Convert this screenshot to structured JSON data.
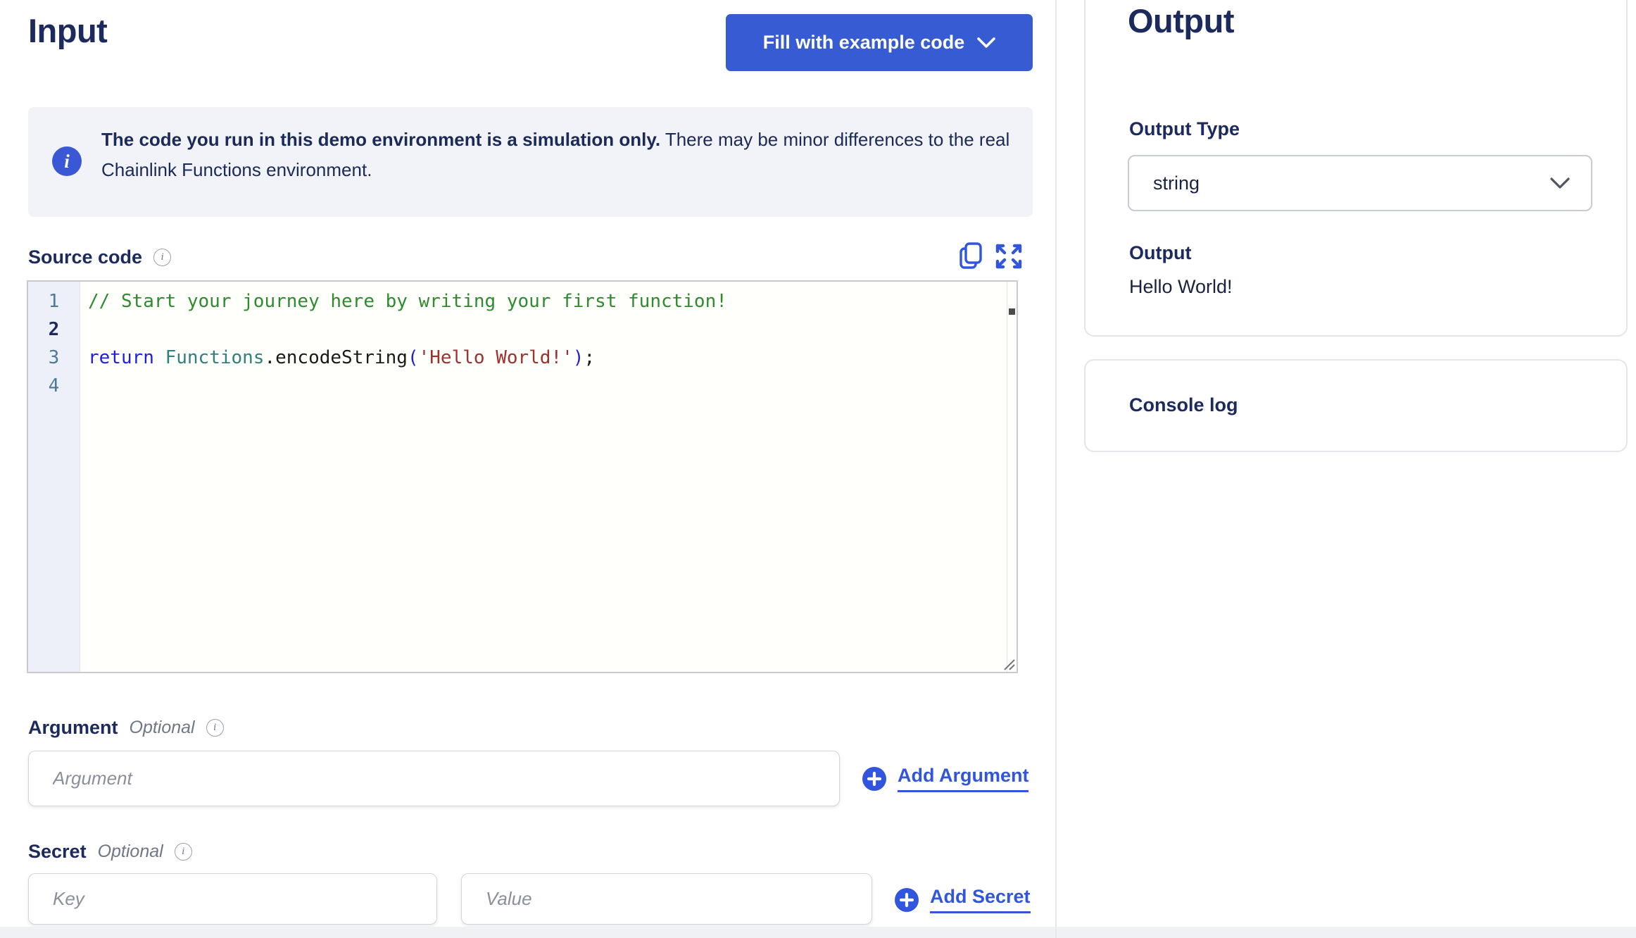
{
  "input_panel": {
    "title": "Input",
    "fill_button_label": "Fill with example code",
    "banner": {
      "icon_glyph": "i",
      "bold": "The code you run in this demo environment is a simulation only.",
      "rest": " There may be minor differences to the real Chainlink Functions environment."
    },
    "source_code_label": "Source code",
    "info_glyph": "i",
    "code_lines": [
      {
        "num": "1",
        "active": false,
        "tokens": [
          {
            "text": "// Start your journey here by writing your first function!",
            "type": "comment"
          }
        ]
      },
      {
        "num": "2",
        "active": true,
        "tokens": []
      },
      {
        "num": "3",
        "active": false,
        "tokens": [
          {
            "text": "return",
            "type": "keyword"
          },
          {
            "text": " ",
            "type": "plain"
          },
          {
            "text": "Functions",
            "type": "variable"
          },
          {
            "text": ".",
            "type": "plain"
          },
          {
            "text": "encodeString",
            "type": "plain"
          },
          {
            "text": "(",
            "type": "paren"
          },
          {
            "text": "'Hello World!'",
            "type": "string"
          },
          {
            "text": ")",
            "type": "paren"
          },
          {
            "text": ";",
            "type": "plain"
          }
        ]
      },
      {
        "num": "4",
        "active": false,
        "tokens": []
      }
    ],
    "argument": {
      "label": "Argument",
      "optional_label": "Optional",
      "placeholder": "Argument",
      "add_label": "Add Argument"
    },
    "secret": {
      "label": "Secret",
      "optional_label": "Optional",
      "key_placeholder": "Key",
      "value_placeholder": "Value",
      "add_label": "Add Secret"
    }
  },
  "output_panel": {
    "title": "Output",
    "output_type_label": "Output Type",
    "output_type_value": "string",
    "output_label": "Output",
    "output_value": "Hello World!",
    "console_label": "Console log"
  },
  "colors": {
    "accent_blue": "#375BD2",
    "link_blue": "#3156dd",
    "heading_navy": "#1c2a5e",
    "body_text": "#17233f",
    "comment_green": "#2e8b2e",
    "keyword_blue": "#2020d8",
    "variable_teal": "#31807e",
    "string_red": "#a03030"
  }
}
